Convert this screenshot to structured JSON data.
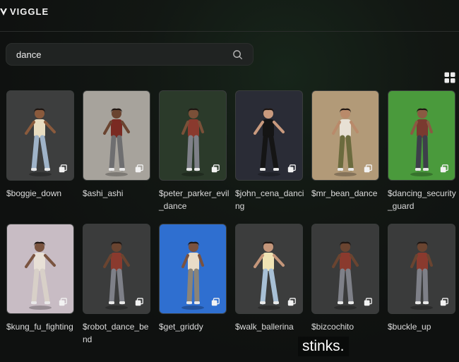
{
  "header": {
    "brand": "VIGGLE"
  },
  "search": {
    "value": "dance",
    "placeholder": ""
  },
  "toolbar": {
    "grid_icon": "grid-icon"
  },
  "templates": [
    {
      "label": "$boggie_down",
      "bg": "#3d3e3e",
      "top": "#e8dcc0",
      "legs": "#9fb3c8",
      "skin": "#8a5a3c"
    },
    {
      "label": "$ashi_ashi",
      "bg": "#a7a39c",
      "top": "#7a2a22",
      "legs": "#6e6e70",
      "skin": "#6a4430"
    },
    {
      "label": "$peter_parker_evil_dance",
      "bg": "#2b3a2a",
      "top": "#8a3a2e",
      "legs": "#7e8088",
      "skin": "#7a5038"
    },
    {
      "label": "$john_cena_dancing",
      "bg": "#2a2c36",
      "top": "#151515",
      "legs": "#151515",
      "skin": "#c99a7e"
    },
    {
      "label": "$mr_bean_dance",
      "bg": "#b29a78",
      "top": "#e7e0d4",
      "legs": "#6b6b3e",
      "skin": "#b98a6a"
    },
    {
      "label": "$dancing_security_guard",
      "bg": "#4a9a3c",
      "top": "#7a3a30",
      "legs": "#3d3f4a",
      "skin": "#8a5a42"
    },
    {
      "label": "$kung_fu_fighting",
      "bg": "#c8bcc4",
      "top": "#e8e0d6",
      "legs": "#d8d0c8",
      "skin": "#7a5440"
    },
    {
      "label": "$robot_dance_bend",
      "bg": "#3b3c3c",
      "top": "#8a3a2e",
      "legs": "#7e8088",
      "skin": "#6a4430"
    },
    {
      "label": "$get_griddy",
      "bg": "#2f6fd0",
      "top": "#e8dcc8",
      "legs": "#8a8478",
      "skin": "#7a5240"
    },
    {
      "label": "$walk_ballerina",
      "bg": "#3c3d3d",
      "top": "#efe3b4",
      "legs": "#a8c0d6",
      "skin": "#c4967a"
    },
    {
      "label": "$bizcochito",
      "bg": "#3a3b3b",
      "top": "#8a3a2e",
      "legs": "#7e8088",
      "skin": "#6a4430"
    },
    {
      "label": "$buckle_up",
      "bg": "#3a3b3b",
      "top": "#8a3a2e",
      "legs": "#7e8088",
      "skin": "#6a4430"
    }
  ],
  "overlay": {
    "subtitle": "stinks."
  }
}
